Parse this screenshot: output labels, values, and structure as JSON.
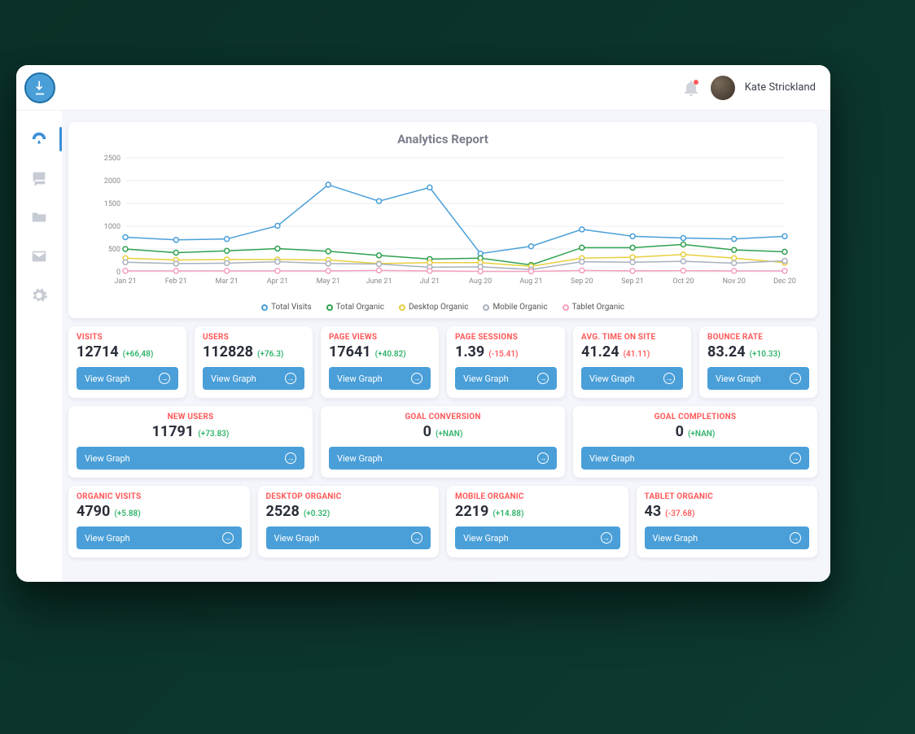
{
  "user": {
    "name": "Kate Strickland"
  },
  "chart_title": "Analytics Report",
  "chart_data": {
    "type": "line",
    "categories": [
      "Jan 21",
      "Feb 21",
      "Mar 21",
      "Apr 21",
      "May 21",
      "June 21",
      "Jul 21",
      "Aug 20",
      "Aug 21",
      "Sep 20",
      "Sep 21",
      "Oct 20",
      "Nov 20",
      "Dec 20"
    ],
    "ylim": [
      0,
      2500
    ],
    "yticks": [
      0,
      500,
      1000,
      1500,
      2000,
      2500
    ],
    "series": [
      {
        "name": "Total Visits",
        "color": "#4a9fd8",
        "values": [
          760,
          700,
          720,
          1010,
          1910,
          1550,
          1850,
          400,
          560,
          930,
          780,
          740,
          720,
          780
        ]
      },
      {
        "name": "Total Organic",
        "color": "#2fa14f",
        "values": [
          500,
          420,
          460,
          510,
          450,
          360,
          280,
          300,
          150,
          530,
          530,
          600,
          480,
          440
        ]
      },
      {
        "name": "Desktop Organic",
        "color": "#e8cf3e",
        "values": [
          300,
          260,
          270,
          270,
          260,
          180,
          200,
          200,
          120,
          300,
          320,
          380,
          300,
          200
        ]
      },
      {
        "name": "Mobile Organic",
        "color": "#a9b1be",
        "values": [
          210,
          180,
          190,
          220,
          180,
          170,
          100,
          110,
          50,
          220,
          210,
          230,
          190,
          240
        ]
      },
      {
        "name": "Tablet Organic",
        "color": "#f4a0c0",
        "values": [
          20,
          20,
          20,
          20,
          20,
          30,
          20,
          10,
          10,
          30,
          20,
          25,
          20,
          20
        ]
      }
    ]
  },
  "buttons": {
    "view_graph": "View Graph"
  },
  "kpi_row1": [
    {
      "title": "VISITS",
      "value": "12714",
      "delta": "(+66,48)",
      "dir": "pos"
    },
    {
      "title": "USERS",
      "value": "112828",
      "delta": "(+76.3)",
      "dir": "pos"
    },
    {
      "title": "PAGE VIEWS",
      "value": "17641",
      "delta": "(+40.82)",
      "dir": "pos"
    },
    {
      "title": "PAGE SESSIONS",
      "value": "1.39",
      "delta": "(-15.41)",
      "dir": "neg"
    },
    {
      "title": "AVG. TIME ON SITE",
      "value": "41.24",
      "delta": "(41.11)",
      "dir": "neg"
    },
    {
      "title": "BOUNCE RATE",
      "value": "83.24",
      "delta": "(+10.33)",
      "dir": "pos"
    }
  ],
  "kpi_row2": [
    {
      "title": "NEW USERS",
      "value": "11791",
      "delta": "(+73.83)",
      "dir": "pos"
    },
    {
      "title": "GOAL CONVERSION",
      "value": "0",
      "delta": "(+NAN)",
      "dir": "pos"
    },
    {
      "title": "GOAL COMPLETIONS",
      "value": "0",
      "delta": "(+NAN)",
      "dir": "pos"
    }
  ],
  "kpi_row3": [
    {
      "title": "ORGANIC VISITS",
      "value": "4790",
      "delta": "(+5.88)",
      "dir": "pos"
    },
    {
      "title": "DESKTOP ORGANIC",
      "value": "2528",
      "delta": "(+0.32)",
      "dir": "pos"
    },
    {
      "title": "MOBILE ORGANIC",
      "value": "2219",
      "delta": "(+14.88)",
      "dir": "pos"
    },
    {
      "title": "TABLET ORGANIC",
      "value": "43",
      "delta": "(-37.68)",
      "dir": "neg"
    }
  ]
}
